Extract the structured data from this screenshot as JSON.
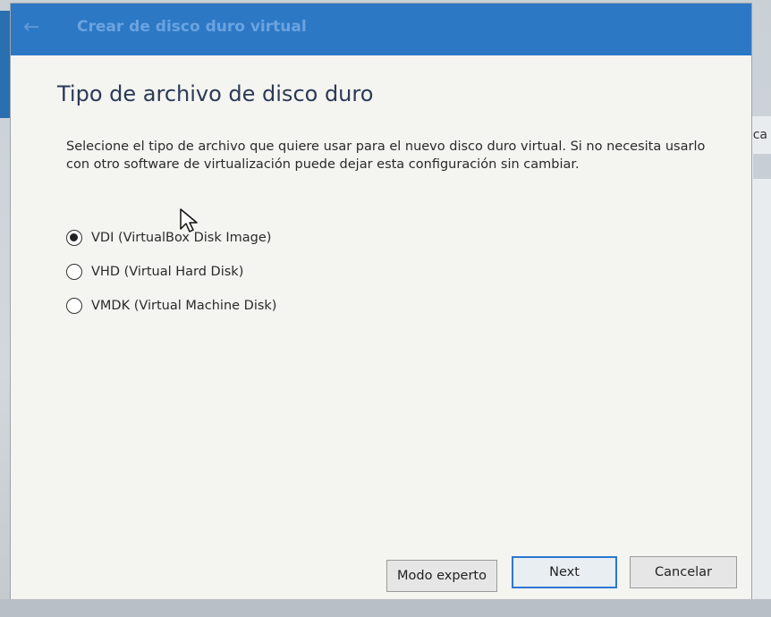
{
  "window": {
    "title": "Crear de disco duro virtual",
    "back_glyph": "←"
  },
  "page": {
    "heading": "Tipo de archivo de disco duro",
    "description": "Selecione el tipo de archivo que quiere usar para el nuevo disco duro virtual. Si no necesita usarlo con otro software de virtualización puede dejar esta configuración sin cambiar."
  },
  "options": [
    {
      "label": "VDI (VirtualBox Disk Image)",
      "selected": true
    },
    {
      "label": "VHD (Virtual Hard Disk)",
      "selected": false
    },
    {
      "label": "VMDK (Virtual Machine Disk)",
      "selected": false
    }
  ],
  "buttons": {
    "expert": "Modo experto",
    "next": "Next",
    "cancel": "Cancelar"
  },
  "background": {
    "right_fragment": "ca"
  },
  "colors": {
    "titlebar": "#2d78c5",
    "next_border": "#2c78d0",
    "dialog_bg": "#f4f4f1"
  }
}
